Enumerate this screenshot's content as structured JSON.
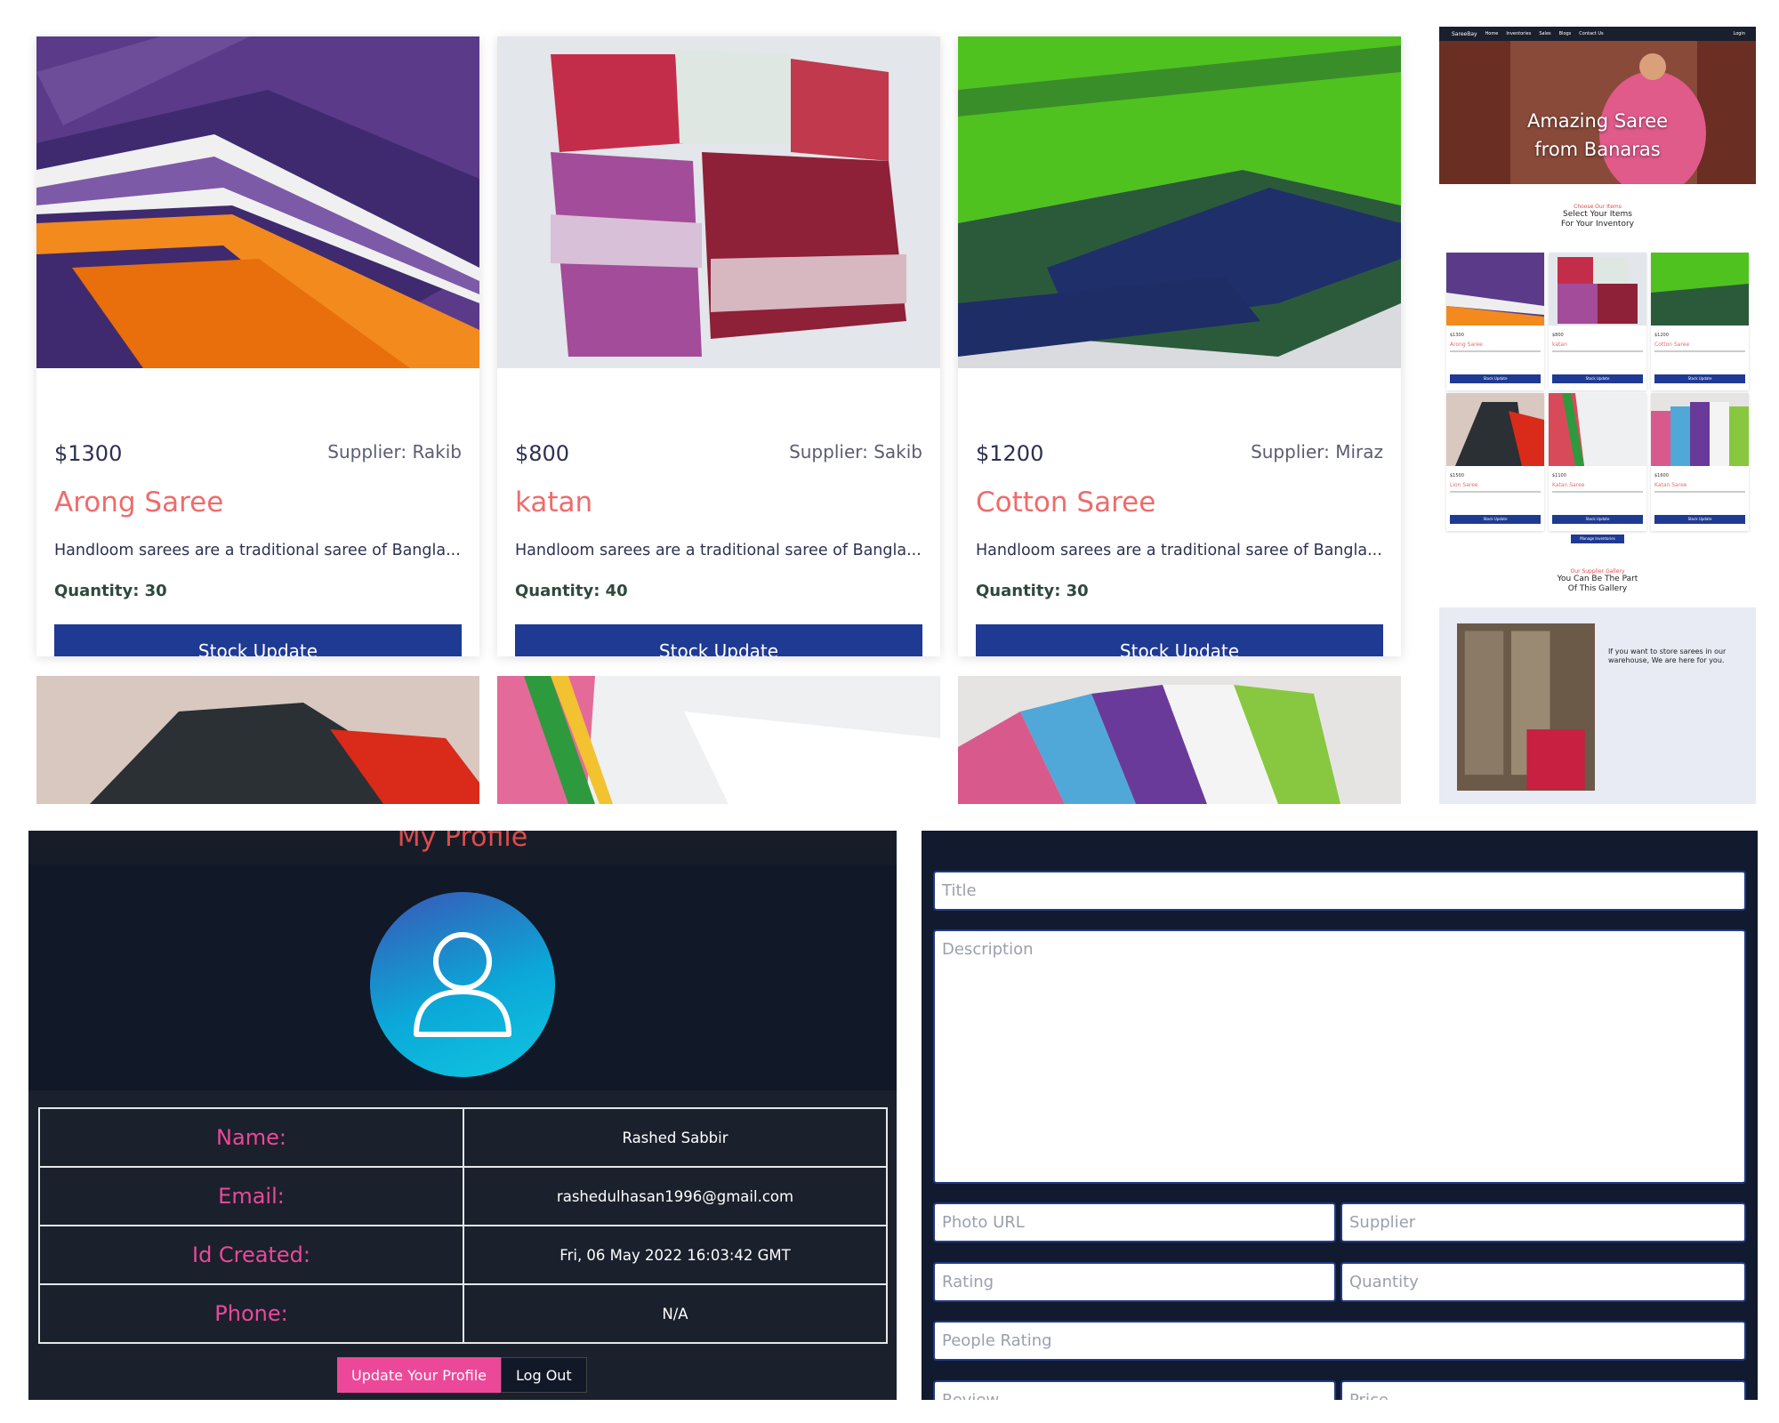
{
  "products": [
    {
      "price": "$1300",
      "supplier": "Supplier: Rakib",
      "title": "Arong Saree",
      "description": "Handloom sarees are a traditional saree of Bangla...",
      "quantity": "Quantity: 30",
      "button": "Stock Update"
    },
    {
      "price": "$800",
      "supplier": "Supplier: Sakib",
      "title": "katan",
      "description": "Handloom sarees are a traditional saree of Bangla...",
      "quantity": "Quantity: 40",
      "button": "Stock Update"
    },
    {
      "price": "$1200",
      "supplier": "Supplier: Miraz",
      "title": "Cotton Saree",
      "description": "Handloom sarees are a traditional saree of Bangla...",
      "quantity": "Quantity: 30",
      "button": "Stock Update"
    }
  ],
  "thumbnail": {
    "brand": "SareeBay",
    "nav": [
      "Home",
      "Inventories",
      "Sales",
      "Blogs",
      "Contact Us",
      "Login"
    ],
    "hero_line1": "Amazing Saree",
    "hero_line2": "from Banaras",
    "section1_small": "Choose Our Items",
    "section1_line1": "Select Your Items",
    "section1_line2": "For Your Inventory",
    "cards": [
      {
        "price": "$1300",
        "title": "Arong Saree",
        "button": "Stock Update"
      },
      {
        "price": "$800",
        "title": "katan",
        "button": "Stock Update"
      },
      {
        "price": "$1200",
        "title": "Cotton Saree",
        "button": "Stock Update"
      },
      {
        "price": "$1500",
        "title": "Lion Saree",
        "button": "Stock Update"
      },
      {
        "price": "$1100",
        "title": "Katan Saree",
        "button": "Stock Update"
      },
      {
        "price": "$1600",
        "title": "Katan Saree",
        "button": "Stock Update"
      }
    ],
    "manage_button": "Manage Inventories",
    "section2_small": "Our Supplier Gallery",
    "section2_line1": "You Can Be The Part",
    "section2_line2": "Of This Gallery",
    "warehouse_text": "If you want to store sarees in our warehouse, We are here for you."
  },
  "profile": {
    "title": "My Profile",
    "rows": [
      {
        "label": "Name:",
        "value": "Rashed Sabbir"
      },
      {
        "label": "Email:",
        "value": "rashedulhasan1996@gmail.com"
      },
      {
        "label": "Id Created:",
        "value": "Fri, 06 May 2022 16:03:42 GMT"
      },
      {
        "label": "Phone:",
        "value": "N/A"
      }
    ],
    "update_button": "Update Your Profile",
    "logout_button": "Log Out"
  },
  "form": {
    "title_placeholder": "Title",
    "description_placeholder": "Description",
    "photo_placeholder": "Photo URL",
    "supplier_placeholder": "Supplier",
    "rating_placeholder": "Rating",
    "quantity_placeholder": "Quantity",
    "people_rating_placeholder": "People Rating",
    "review_placeholder": "Review",
    "price_placeholder": "Price"
  },
  "colors": {
    "accent_blue": "#1f3a93",
    "title_red": "#ef6b6b",
    "profile_pink": "#ec4899",
    "dark_bg": "#111827"
  }
}
